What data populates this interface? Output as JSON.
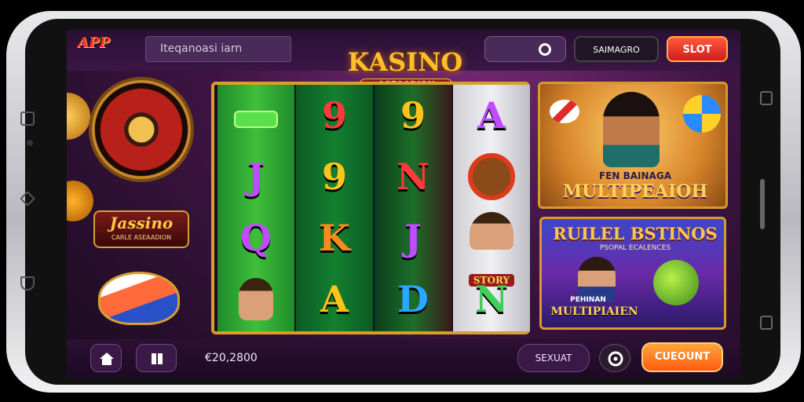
{
  "header": {
    "logo_text": "APP",
    "search_text": "Iteqanoasi iarn",
    "title": "KASINO",
    "subtitle": "ASEAADION",
    "center_pill_icon": "chip-icon",
    "account_label": "SAIMAGRO",
    "slot_label": "SLOT"
  },
  "left_panel": {
    "logo_text": "Jassino",
    "logo_subtext": "CARLE ASEAADION"
  },
  "reels": [
    {
      "symbols": [
        "",
        "J",
        "Q",
        ""
      ],
      "colors": [
        "#3fd05a",
        "#c04cff",
        "#c04cff",
        ""
      ]
    },
    {
      "symbols": [
        "9",
        "9",
        "K",
        "A"
      ],
      "colors": [
        "#ff3a3a",
        "#ffc41a",
        "#ff8a1a",
        "#ffc41a"
      ]
    },
    {
      "symbols": [
        "9",
        "N",
        "J",
        "D"
      ],
      "colors": [
        "#ffc41a",
        "#ff3a3a",
        "#c04cff",
        "#28a8ff"
      ]
    },
    {
      "symbols": [
        "A",
        "",
        "",
        "N"
      ],
      "colors": [
        "#c04cff",
        "",
        "",
        "#3fd05a"
      ]
    }
  ],
  "reel_badge": "STORY",
  "promo_top": {
    "label_small": "FEN BAINAGA",
    "label_big": "MULTIPEAIOH"
  },
  "promo_bottom": {
    "title": "RUILEL BSTINOS",
    "subtitle": "PSOPAL ECALENCES",
    "label_small": "PEHINAN",
    "label_big": "MULTIPIAIEN"
  },
  "footer": {
    "balance": "€20,2800",
    "select_label": "SEXUAT",
    "spin_label": "CUEOUNT",
    "home_icon": "home-icon",
    "menu_icon": "grid-icon",
    "settings_icon": "gear-icon"
  },
  "colors": {
    "accent_gold": "#d6a030",
    "accent_orange": "#ff7a18",
    "bg_purple": "#3f1444"
  }
}
